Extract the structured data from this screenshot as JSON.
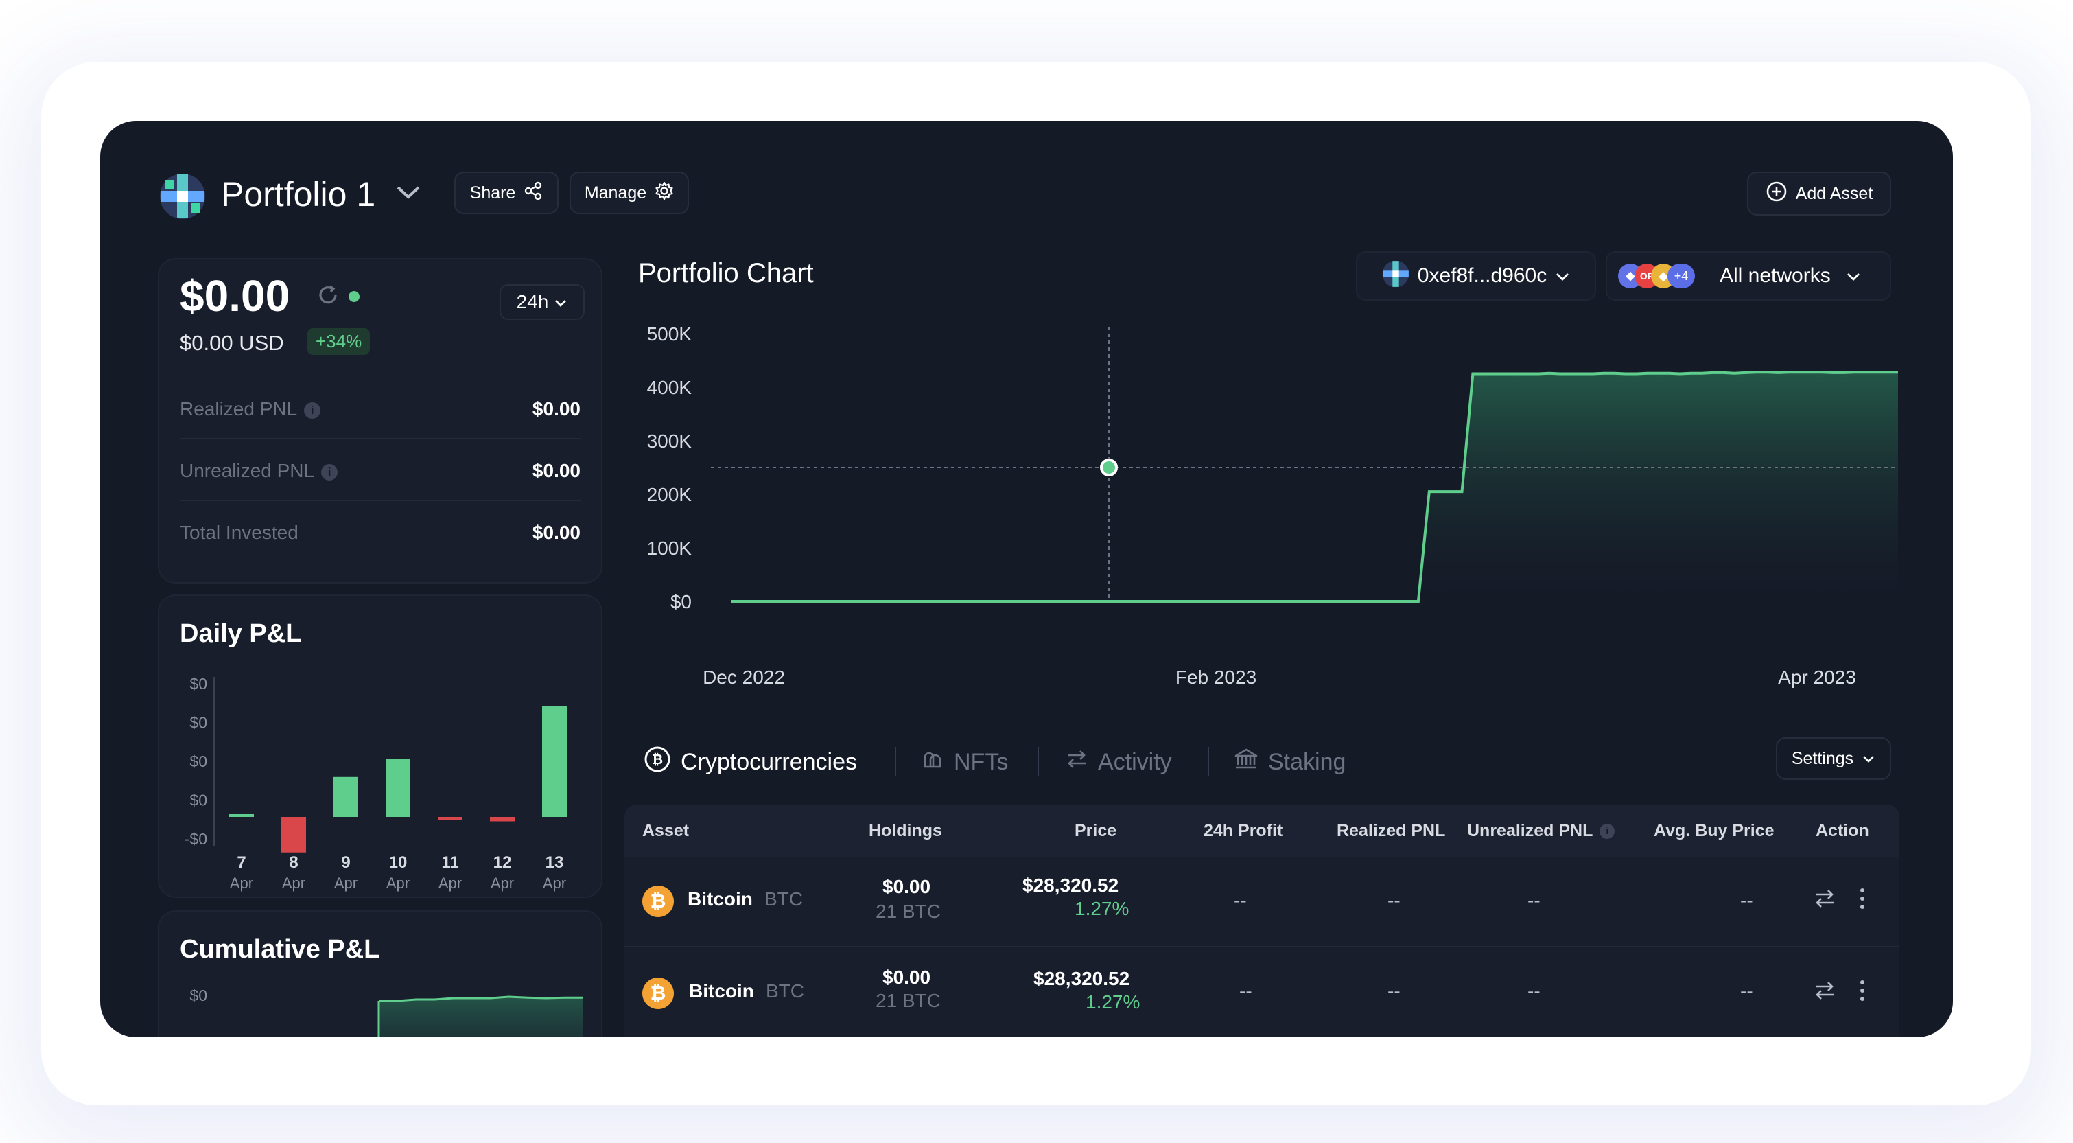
{
  "header": {
    "portfolio_name": "Portfolio 1",
    "share_label": "Share",
    "manage_label": "Manage",
    "add_asset_label": "Add Asset"
  },
  "summary": {
    "balance": "$0.00",
    "usd_value": "$0.00 USD",
    "change_badge": "+34%",
    "period": "24h",
    "rows": [
      {
        "label": "Realized PNL",
        "value": "$0.00",
        "info": true
      },
      {
        "label": "Unrealized PNL",
        "value": "$0.00",
        "info": true
      },
      {
        "label": "Total Invested",
        "value": "$0.00",
        "info": false
      }
    ]
  },
  "daily_pnl": {
    "title": "Daily P&L"
  },
  "cumulative_pnl": {
    "title": "Cumulative P&L",
    "y_label": "$0"
  },
  "portfolio_chart": {
    "title": "Portfolio Chart",
    "wallet": "0xef8f...d960c",
    "networks_label": "All networks",
    "networks_more": "+4",
    "network_badge_text": "OP"
  },
  "tabs": [
    {
      "label": "Cryptocurrencies",
      "icon": "bitcoin-circle-icon",
      "active": true
    },
    {
      "label": "NFTs",
      "icon": "nft-icon",
      "active": false
    },
    {
      "label": "Activity",
      "icon": "arrows-swap-icon",
      "active": false
    },
    {
      "label": "Staking",
      "icon": "bank-icon",
      "active": false
    }
  ],
  "settings_label": "Settings",
  "table": {
    "columns": [
      "Asset",
      "Holdings",
      "Price",
      "24h Profit",
      "Realized PNL",
      "Unrealized PNL",
      "Avg. Buy Price",
      "Action"
    ],
    "rows": [
      {
        "name": "Bitcoin",
        "symbol": "BTC",
        "holdings_value": "$0.00",
        "holdings_amount": "21 BTC",
        "price": "$28,320.52",
        "change": "1.27%",
        "profit_24h": "--",
        "realized": "--",
        "unrealized": "--",
        "avg_buy": "--"
      },
      {
        "name": "Bitcoin",
        "symbol": "BTC",
        "holdings_value": "$0.00",
        "holdings_amount": "21 BTC",
        "price": "$28,320.52",
        "change": "1.27%",
        "profit_24h": "--",
        "realized": "--",
        "unrealized": "--",
        "avg_buy": "--"
      }
    ]
  },
  "colors": {
    "background": "#151a27",
    "panel": "#181e2c",
    "positive": "#5fce8d",
    "negative": "#d9474a",
    "bitcoin": "#f4a234"
  },
  "chart_data": [
    {
      "type": "line",
      "title": "Portfolio Chart",
      "y_ticks": [
        "500K",
        "400K",
        "300K",
        "200K",
        "100K",
        "$0"
      ],
      "ylim": [
        0,
        500000
      ],
      "x_ticks": [
        "Dec 2022",
        "Feb 2023",
        "Apr 2023"
      ],
      "series": [
        {
          "values": [
            0,
            0,
            0,
            0,
            0,
            0,
            0,
            0,
            0,
            0,
            0,
            0,
            0,
            0,
            0,
            0,
            0,
            0,
            0,
            0,
            0,
            0,
            0,
            0,
            0,
            0,
            0,
            0,
            0,
            0,
            0,
            0,
            0,
            0,
            0,
            0,
            0,
            0,
            0,
            0,
            0,
            0,
            0,
            0,
            0,
            0,
            0,
            0,
            0,
            0,
            0,
            0,
            0,
            0,
            0,
            0,
            0,
            0,
            0,
            0,
            0,
            0,
            0,
            0,
            205000,
            205000,
            205000,
            205000,
            425000,
            425000,
            425000,
            425000,
            425000,
            425000,
            425000,
            426000,
            425000,
            425000,
            425000,
            425000,
            426000,
            426000,
            425000,
            425000,
            426000,
            426000,
            426000,
            425000,
            426000,
            426000,
            427000,
            427000,
            426000,
            427000,
            428000,
            428000,
            427000,
            428000,
            428000,
            428000,
            428000,
            427000,
            427000,
            428000,
            428000,
            428000,
            428000,
            428000
          ]
        }
      ],
      "hover_value": 250000,
      "grid": false
    },
    {
      "type": "bar",
      "title": "Daily P&L",
      "categories": [
        "7 Apr",
        "8 Apr",
        "9 Apr",
        "10 Apr",
        "11 Apr",
        "12 Apr",
        "13 Apr"
      ],
      "day_labels": [
        "7",
        "8",
        "9",
        "10",
        "11",
        "12",
        "13"
      ],
      "month_label": "Apr",
      "y_ticks": [
        "$0",
        "$0",
        "$0",
        "$0",
        "-$0"
      ],
      "values": [
        0,
        -0.8,
        0.9,
        1.3,
        -0.05,
        -0.1,
        2.5
      ],
      "ylim": [
        -1.1,
        3.0
      ]
    },
    {
      "type": "area",
      "title": "Cumulative P&L",
      "y_ticks": [
        "$0"
      ],
      "values": [
        0.5,
        0.5,
        0.55,
        0.55,
        0.6,
        0.6,
        0.6,
        0.65,
        0.62,
        0.6,
        0.62,
        0.62
      ]
    }
  ]
}
